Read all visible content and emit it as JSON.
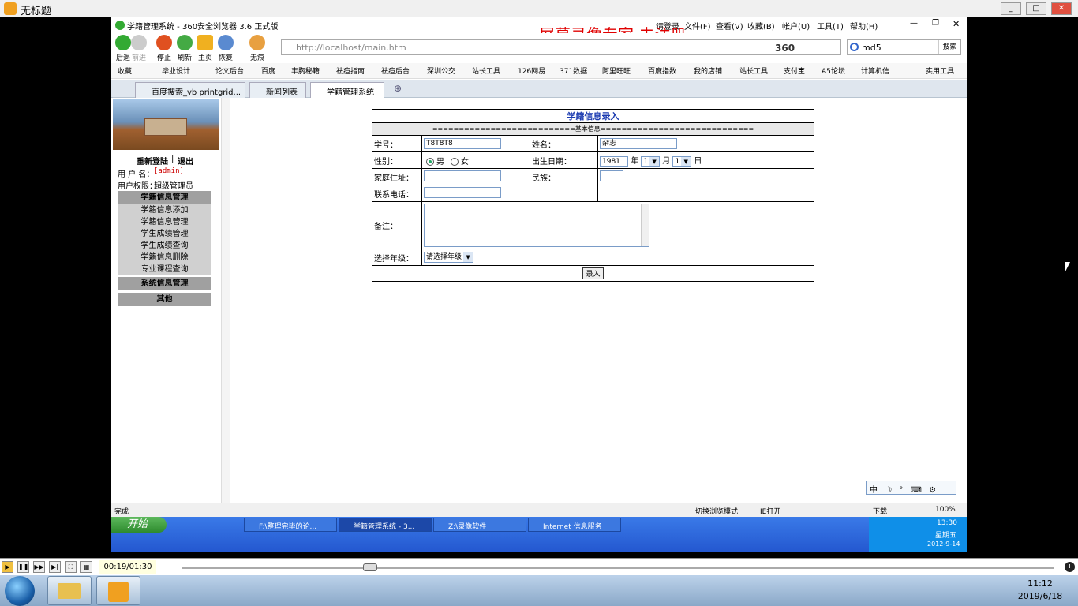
{
  "player": {
    "title": "无标题",
    "time": "00:19/01:30",
    "seek_progress": 0.2,
    "accent": "#f0a020"
  },
  "browser": {
    "title": "学籍管理系统 - 360安全浏览器 3.6 正式版",
    "menu": [
      "请登录",
      "文件(F)",
      "查看(V)",
      "收藏(B)",
      "帐户(U)",
      "工具(T)",
      "帮助(H)"
    ],
    "watermark": "屏幕录像专家  未注册",
    "toolbar": {
      "back": "后退",
      "forward": "前进",
      "stop": "停止",
      "refresh": "刷新",
      "home": "主页",
      "restore": "恢复",
      "incognito": "无痕"
    },
    "address": "http://localhost/main.htm",
    "brand": "360",
    "search_value": "md5",
    "search_button": "搜索",
    "favorites_label": "收藏",
    "favorites": [
      "毕业设计",
      "论文后台",
      "百度",
      "丰胸秘籍",
      "祛痘指南",
      "祛痘后台",
      "深圳公交",
      "站长工具",
      "126网易",
      "371数据",
      "阿里旺旺",
      "百度指数",
      "我的店铺",
      "站长工具",
      "支付宝",
      "A5论坛",
      "计算机信"
    ],
    "practical_tools": "实用工具",
    "tabs": [
      {
        "label": "百度搜索_vb printgrid...",
        "active": false
      },
      {
        "label": "新闻列表",
        "active": false
      },
      {
        "label": "学籍管理系统",
        "active": true
      }
    ]
  },
  "sidebar": {
    "relogin": "重新登陆",
    "sep": "|",
    "logout": "退出",
    "user_label": "用 户 名：",
    "user_value": "[admin]",
    "role_label": "用户权限：",
    "role_value": "超级管理员",
    "sections": [
      {
        "title": "学籍信息管理",
        "items": [
          "学籍信息添加",
          "学籍信息管理",
          "学生成绩管理",
          "学生成绩查询",
          "学籍信息删除",
          "专业课程查询"
        ]
      },
      {
        "title": "系统信息管理",
        "items": []
      },
      {
        "title": "其他",
        "items": []
      }
    ]
  },
  "form": {
    "title": "学籍信息录入",
    "subtitle": "===========================基本信息=============================",
    "student_id_label": "学号：",
    "student_id_value": "T8T8T8",
    "name_label": "姓名：",
    "name_value": "杂志",
    "gender_label": "性别：",
    "male": "男",
    "female": "女",
    "birth_label": "出生日期：",
    "birth_year": "1981",
    "year_unit": "年",
    "birth_month": "1",
    "month_unit": "月",
    "birth_day": "1",
    "day_unit": "日",
    "address_label": "家庭住址：",
    "ethnic_label": "民族：",
    "phone_label": "联系电话：",
    "remark_label": "备注：",
    "grade_label": "选择年级：",
    "grade_value": "请选择年级",
    "submit": "录入"
  },
  "statusbar": {
    "done": "完成",
    "mode": "切换浏览模式",
    "ie": "IE打开",
    "download": "下载",
    "zoom": "100%"
  },
  "xp_taskbar": {
    "start": "开始",
    "tasks": [
      "F:\\整理完毕的论...",
      "学籍管理系统 - 3...",
      "Z:\\录像软件",
      "Internet 信息服务"
    ],
    "time": "13:30",
    "weekday": "星期五",
    "date": "2012-9-14"
  },
  "win7": {
    "time": "11:12",
    "date": "2019/6/18"
  }
}
